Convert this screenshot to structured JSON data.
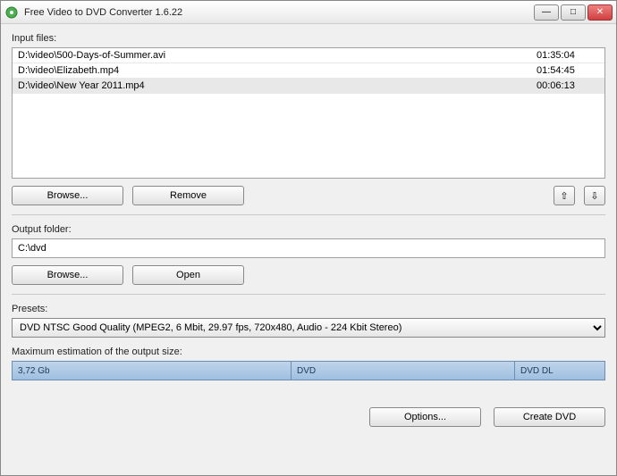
{
  "window": {
    "title": "Free Video to DVD Converter 1.6.22"
  },
  "labels": {
    "input_files": "Input files:",
    "output_folder": "Output folder:",
    "presets": "Presets:",
    "max_estimation": "Maximum estimation of the output size:"
  },
  "files": [
    {
      "path": "D:\\video\\500-Days-of-Summer.avi",
      "duration": "01:35:04"
    },
    {
      "path": "D:\\video\\Elizabeth.mp4",
      "duration": "01:54:45"
    },
    {
      "path": "D:\\video\\New Year 2011.mp4",
      "duration": "00:06:13"
    }
  ],
  "buttons": {
    "browse": "Browse...",
    "remove": "Remove",
    "open": "Open",
    "options": "Options...",
    "create_dvd": "Create DVD"
  },
  "output_folder_value": "C:\\dvd",
  "preset_selected": "DVD NTSC Good Quality (MPEG2, 6 Mbit, 29.97 fps, 720x480, Audio - 224 Kbit Stereo)",
  "estimation": {
    "size": "3,72 Gb",
    "dvd": "DVD",
    "dvddl": "DVD DL"
  },
  "icons": {
    "arrow_up": "⇧",
    "arrow_down": "⇩",
    "minimize": "—",
    "maximize": "□",
    "close": "✕"
  }
}
